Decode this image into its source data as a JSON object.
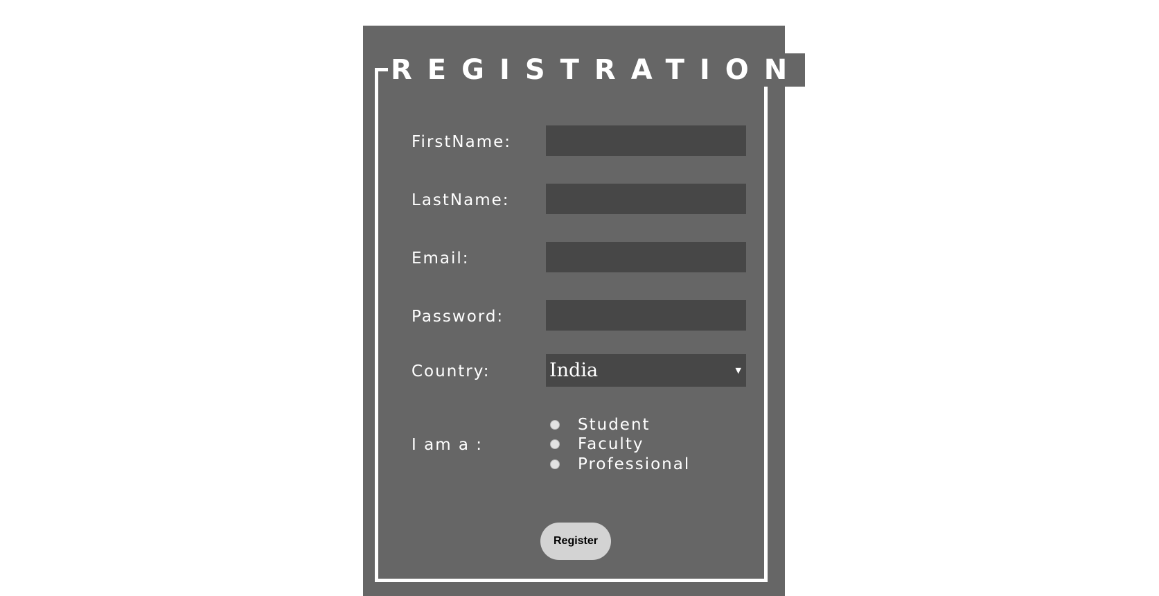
{
  "form": {
    "title": "REGISTRATION",
    "fields": [
      {
        "label": "FirstName:",
        "value": ""
      },
      {
        "label": "LastName:",
        "value": ""
      },
      {
        "label": "Email:",
        "value": ""
      },
      {
        "label": "Password:",
        "value": ""
      }
    ],
    "country": {
      "label": "Country:",
      "selected": "India"
    },
    "role": {
      "label": "I am a :",
      "options": [
        "Student",
        "Faculty",
        "Professional"
      ]
    },
    "submit_label": "Register"
  },
  "colors": {
    "panel_background": "#666666",
    "field_background": "#474747",
    "frame_border": "#ffffff",
    "button_background": "#d3d3d3"
  },
  "icons": {
    "select_caret": "caret-down-icon"
  }
}
